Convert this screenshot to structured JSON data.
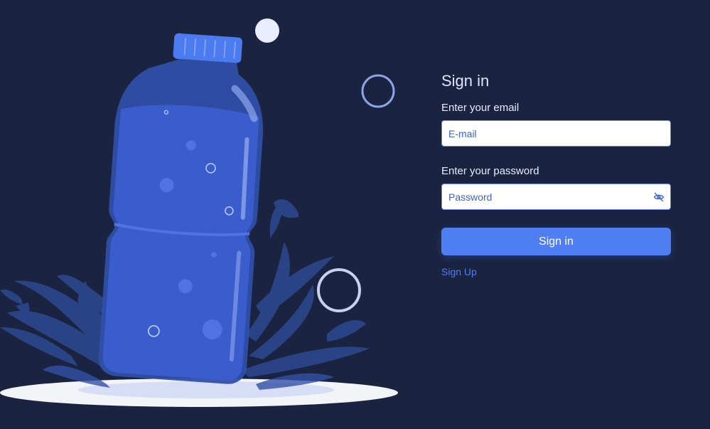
{
  "signin": {
    "title": "Sign in",
    "email_label": "Enter your email",
    "email_placeholder": "E-mail",
    "email_value": "",
    "password_label": "Enter your password",
    "password_placeholder": "Password",
    "password_value": "",
    "password_toggle_icon": "eye-off-icon",
    "submit_label": "Sign in",
    "signup_label": "Sign Up"
  },
  "colors": {
    "background": "#1a2441",
    "accent": "#4f7df2",
    "title": "#dfe4ff",
    "bottle": "#3a5ccc"
  }
}
